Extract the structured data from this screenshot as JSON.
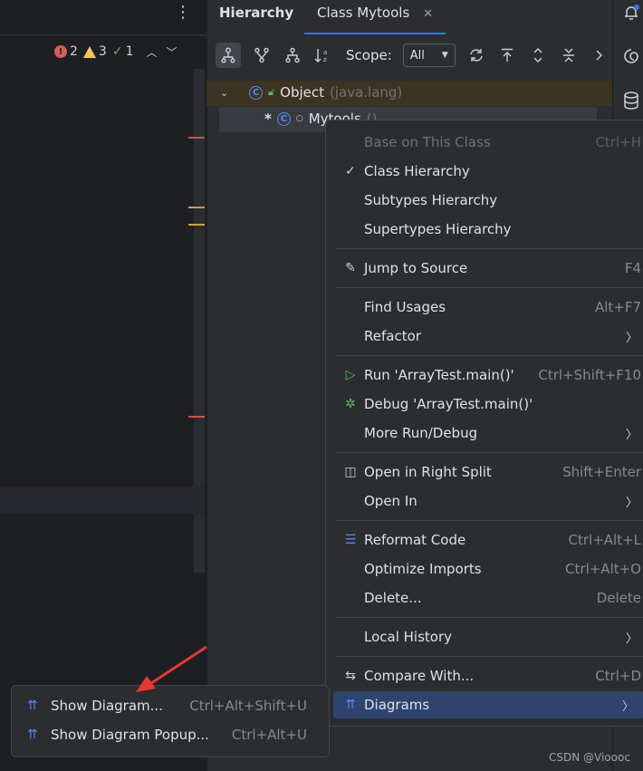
{
  "editor": {
    "kebab_icon": "⋮",
    "inspections": {
      "errors": "2",
      "warnings": "3",
      "passed": "1"
    }
  },
  "panel": {
    "tab_hierarchy": "Hierarchy",
    "tab_class": "Class Mytools",
    "tab_close": "✕",
    "scope_label": "Scope:",
    "scope_value": "All",
    "tree": [
      {
        "name": "Object",
        "detail": "(java.lang)"
      },
      {
        "prefix": "*",
        "name": "Mytools",
        "detail": "()"
      }
    ]
  },
  "context_menu": {
    "items": [
      {
        "label": "Base on This Class",
        "shortcut": "Ctrl+H",
        "disabled": true
      },
      {
        "label": "Class Hierarchy",
        "icon": "check-icon",
        "checked": true
      },
      {
        "label": "Subtypes Hierarchy"
      },
      {
        "label": "Supertypes Hierarchy"
      },
      {
        "label": "Jump to Source",
        "shortcut": "F4",
        "icon": "pencil-icon"
      },
      {
        "label": "Find Usages",
        "shortcut": "Alt+F7"
      },
      {
        "label": "Refactor",
        "submenu": true
      },
      {
        "label": "Run 'ArrayTest.main()'",
        "shortcut": "Ctrl+Shift+F10",
        "icon": "run-icon"
      },
      {
        "label": "Debug 'ArrayTest.main()'",
        "icon": "debug-icon"
      },
      {
        "label": "More Run/Debug",
        "submenu": true
      },
      {
        "label": "Open in Right Split",
        "shortcut": "Shift+Enter",
        "icon": "split-icon"
      },
      {
        "label": "Open In",
        "submenu": true
      },
      {
        "label": "Reformat Code",
        "shortcut": "Ctrl+Alt+L",
        "icon": "reformat-icon"
      },
      {
        "label": "Optimize Imports",
        "shortcut": "Ctrl+Alt+O"
      },
      {
        "label": "Delete...",
        "shortcut": "Delete"
      },
      {
        "label": "Local History",
        "submenu": true
      },
      {
        "label": "Compare With...",
        "shortcut": "Ctrl+D",
        "icon": "compare-icon"
      },
      {
        "label": "Diagrams",
        "submenu": true,
        "icon": "diagram-icon",
        "selected": true
      }
    ]
  },
  "submenu": {
    "items": [
      {
        "label": "Show Diagram...",
        "shortcut": "Ctrl+Alt+Shift+U"
      },
      {
        "label": "Show Diagram Popup...",
        "shortcut": "Ctrl+Alt+U"
      }
    ]
  },
  "watermark": "CSDN @Vioooc",
  "colors": {
    "accent": "#3574f0",
    "selection": "#2e436e",
    "error": "#db5c5c",
    "warning": "#f2c55c",
    "success": "#5fb865",
    "arrow": "#e53935"
  }
}
